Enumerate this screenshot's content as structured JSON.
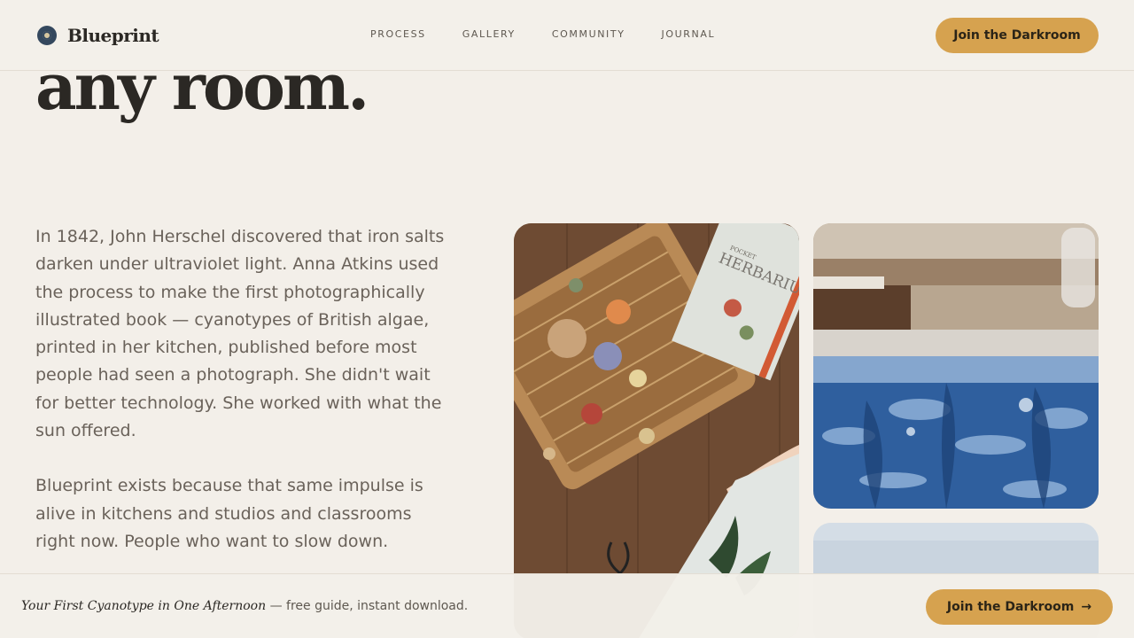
{
  "header": {
    "brand": "Blueprint",
    "nav": [
      "PROCESS",
      "GALLERY",
      "COMMUNITY",
      "JOURNAL"
    ],
    "cta": "Join the Darkroom"
  },
  "hero": {
    "title_tail": "any room."
  },
  "story": {
    "p1": "In 1842, John Herschel discovered that iron salts darken under ultraviolet light. Anna Atkins used the process to make the first photographically illustrated book — cyanotypes of British algae, printed in her kitchen, published before most people had seen a photograph. She didn't wait for better technology. She worked with what the sun offered.",
    "p2": "Blueprint exists because that same impulse is alive in kitchens and studios and classrooms right now. People who want to slow down."
  },
  "images": {
    "book_title": "HERBARIUM",
    "book_series": "POCKET"
  },
  "footer": {
    "offer_title": "Your First Cyanotype in One Afternoon",
    "offer_rest": " — free guide, instant download.",
    "cta": "Join the Darkroom",
    "cta_arrow": "→"
  },
  "colors": {
    "background": "#f3efe9",
    "accent": "#d6a24f",
    "text": "#2b2824",
    "muted": "#6a625a"
  }
}
